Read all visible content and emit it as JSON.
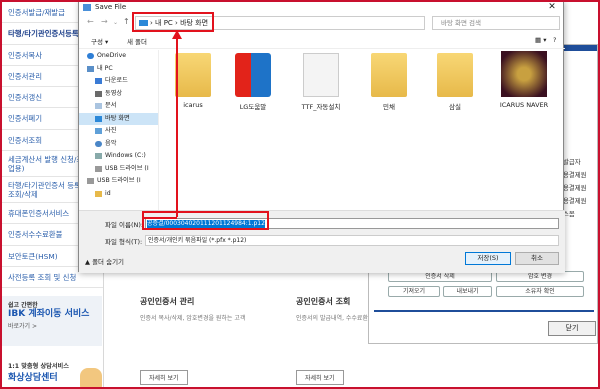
{
  "leftnav": {
    "items": [
      {
        "label": "인증서발급/재발급"
      },
      {
        "label": "타행/타기관인증서등록"
      },
      {
        "label": "인증서복사"
      },
      {
        "label": "인증서관리"
      },
      {
        "label": "인증서갱신"
      },
      {
        "label": "인증서폐기"
      },
      {
        "label": "인증서조회"
      },
      {
        "label": "세금계산서 발행 신청/조회(기업용)"
      },
      {
        "label": "타행/타기관인증서 등록 내역조회/삭제"
      },
      {
        "label": "휴대폰인증서서비스"
      },
      {
        "label": "인증서수수료환불"
      },
      {
        "label": "보안토큰(HSM)"
      },
      {
        "label": "사전등록 조회 및 신청"
      }
    ],
    "promo1": {
      "small": "쉽고 간편한",
      "big": "IBK 계좌이동 서비스",
      "link": "바로가기 >"
    },
    "promo2": {
      "small": "1:1 맞춤형 상담서비스",
      "big": "화상상담센터"
    }
  },
  "cards": [
    {
      "title": "공인인증서 관리",
      "desc": "인증서 복사/삭제, 암호변경을 원하는 고객",
      "btn": "자세히 보기"
    },
    {
      "title": "공인인증서 조회",
      "desc": "인증서의 발급내역, 수수료환불 신청 등의 정보 확인",
      "btn": "자세히 보기"
    }
  ],
  "right_dialog": {
    "texts": [
      "발급자",
      "용결제원",
      "용결제원",
      "용결제원",
      "스몸"
    ],
    "buttons": {
      "delete": "인증서 삭제",
      "pw": "암호 변경",
      "export": "기져오기",
      "import": "내보내기",
      "owner": "소유자 확인",
      "close": "닫기"
    }
  },
  "save_dialog": {
    "title": "Save File",
    "breadcrumb": [
      "내 PC",
      "바탕 화면"
    ],
    "search_placeholder": "바탕 화면 검색",
    "toolbar": {
      "organize": "구성 ▾",
      "new_folder": "새 폴더"
    },
    "nav": [
      {
        "label": "OneDrive",
        "icon": "cloud-icon"
      },
      {
        "label": "내 PC",
        "icon": "pc-icon"
      },
      {
        "label": "다운로드",
        "icon": "download-icon"
      },
      {
        "label": "동영상",
        "icon": "video-icon"
      },
      {
        "label": "문서",
        "icon": "document-icon"
      },
      {
        "label": "바탕 화면",
        "icon": "desktop-icon"
      },
      {
        "label": "사진",
        "icon": "picture-icon"
      },
      {
        "label": "음악",
        "icon": "music-icon"
      },
      {
        "label": "Windows (C:)",
        "icon": "drive-icon"
      },
      {
        "label": "USB 드라이브 (I",
        "icon": "usb-icon"
      },
      {
        "label": "USB 드라이브 (I",
        "icon": "usb-icon"
      },
      {
        "label": "id",
        "icon": "folder-icon"
      }
    ],
    "files": [
      {
        "label": "icarus",
        "kind": "folder"
      },
      {
        "label": "LG도움말",
        "kind": "app"
      },
      {
        "label": "TTF_자동설치",
        "kind": "doc"
      },
      {
        "label": "민채",
        "kind": "folder"
      },
      {
        "label": "삼실",
        "kind": "folder"
      },
      {
        "label": "ICARUS NAVER",
        "kind": "game"
      }
    ],
    "filename_label": "파일 이름(N):",
    "filename_value": "공증결/000304020111201124984:1.p12",
    "filetype_label": "파일 형식(T):",
    "filetype_value": "인증서/개인키 묶음파일 (*.pfx *.p12)",
    "save": "저장(S)",
    "cancel": "취소",
    "hide_folders": "▲ 폴더 숨기기"
  },
  "colors": {
    "accent": "#2b5fab",
    "highlight": "#e2121d",
    "selection": "#0078d7"
  }
}
